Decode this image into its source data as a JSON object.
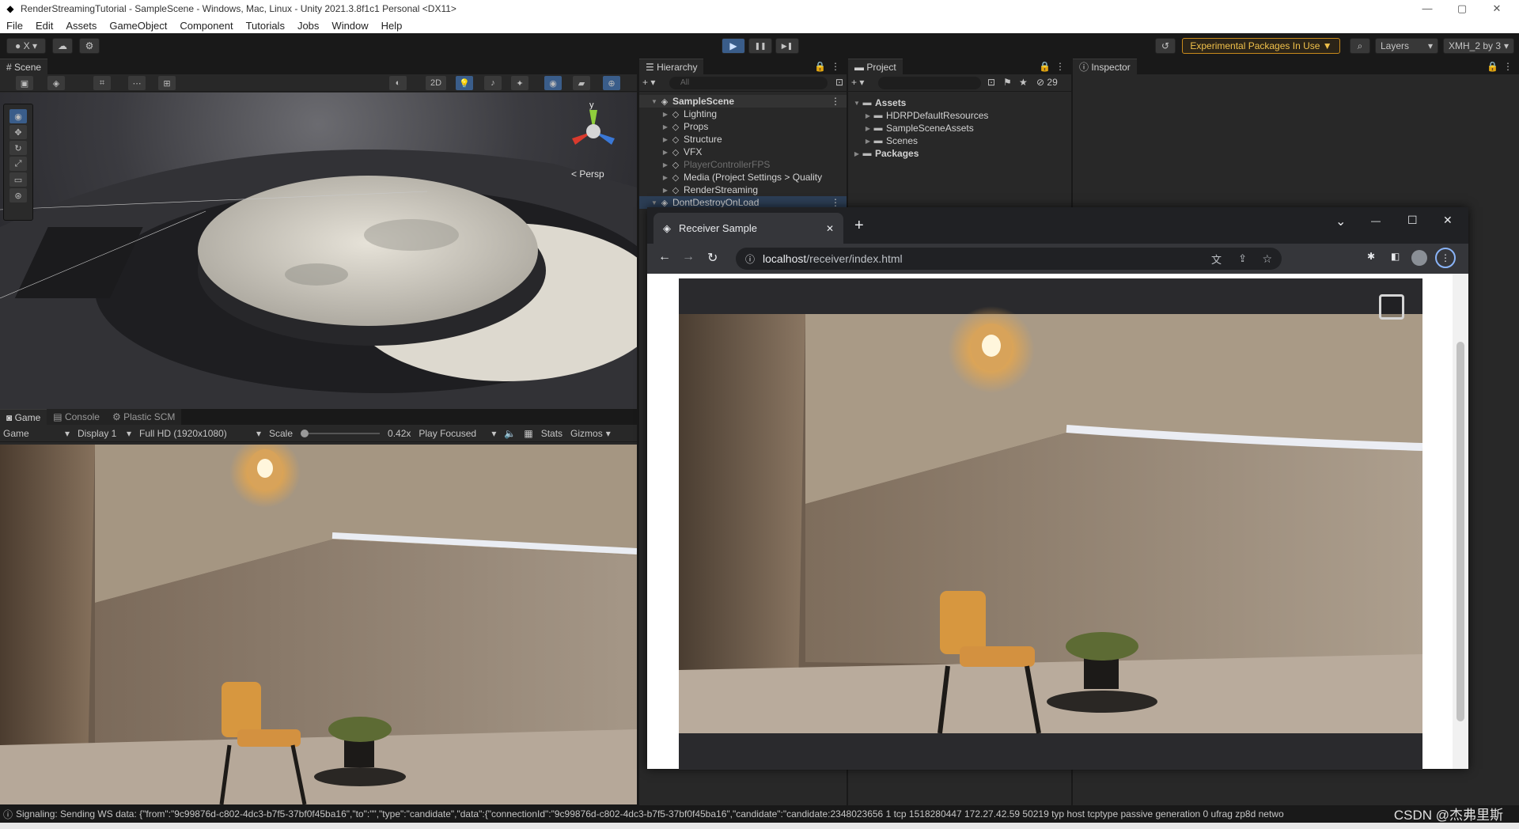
{
  "window": {
    "title": "RenderStreamingTutorial - SampleScene - Windows, Mac, Linux - Unity 2021.3.8f1c1 Personal <DX11>",
    "minimize": "—",
    "maximize": "▢",
    "close": "✕"
  },
  "menu": [
    "File",
    "Edit",
    "Assets",
    "GameObject",
    "Component",
    "Tutorials",
    "Jobs",
    "Window",
    "Help"
  ],
  "toolbar": {
    "account": "X",
    "play": "▶",
    "pause": "❚❚",
    "step": "▶❚",
    "experimental": "Experimental Packages In Use ▼",
    "layers": "Layers",
    "layout": "XMH_2 by 3"
  },
  "scene": {
    "tab": "Scene",
    "mode_2d": "2D",
    "persp_label": "< Persp",
    "gizmo_y": "y"
  },
  "game": {
    "tabs": [
      "Game",
      "Console",
      "Plastic SCM"
    ],
    "display_mode": "Game",
    "display": "Display 1",
    "resolution": "Full HD (1920x1080)",
    "scale_label": "Scale",
    "scale_value": "0.42x",
    "play_focused": "Play Focused",
    "stats": "Stats",
    "gizmos": "Gizmos"
  },
  "hierarchy": {
    "tab": "Hierarchy",
    "search_placeholder": "All",
    "items": [
      {
        "label": "SampleScene",
        "depth": 0,
        "type": "scene"
      },
      {
        "label": "Lighting",
        "depth": 1
      },
      {
        "label": "Props",
        "depth": 1
      },
      {
        "label": "Structure",
        "depth": 1
      },
      {
        "label": "VFX",
        "depth": 1
      },
      {
        "label": "PlayerControllerFPS",
        "depth": 1,
        "disabled": true
      },
      {
        "label": "Media (Project Settings > Quality",
        "depth": 1
      },
      {
        "label": "RenderStreaming",
        "depth": 1
      },
      {
        "label": "DontDestroyOnLoad",
        "depth": 0,
        "type": "scene",
        "selected": true
      }
    ]
  },
  "project": {
    "tab": "Project",
    "hidden_count": "29",
    "tree": [
      {
        "label": "Assets",
        "depth": 0,
        "bold": true
      },
      {
        "label": "HDRPDefaultResources",
        "depth": 1
      },
      {
        "label": "SampleSceneAssets",
        "depth": 1
      },
      {
        "label": "Scenes",
        "depth": 1
      },
      {
        "label": "Packages",
        "depth": 0,
        "bold": true
      }
    ]
  },
  "inspector": {
    "tab": "Inspector"
  },
  "browser": {
    "tab_title": "Receiver Sample",
    "new_tab": "+",
    "url_host": "localhost",
    "url_path": "/receiver/index.html",
    "min": "—",
    "max": "☐",
    "close": "✕",
    "menu_chevron": "⌄"
  },
  "status": {
    "message": "Signaling: Sending WS data: {\"from\":\"9c99876d-c802-4dc3-b7f5-37bf0f45ba16\",\"to\":\"\",\"type\":\"candidate\",\"data\":{\"connectionId\":\"9c99876d-c802-4dc3-b7f5-37bf0f45ba16\",\"candidate\":\"candidate:2348023656 1 tcp 1518280447 172.27.42.59 50219 typ host tcptype passive generation 0 ufrag zp8d netwo",
    "watermark": "CSDN @杰弗里斯"
  },
  "colors": {
    "accent_blue": "#3a79bb",
    "warning_orange": "#c88a1b",
    "panel_bg": "#282828",
    "dark_bg": "#191919"
  }
}
